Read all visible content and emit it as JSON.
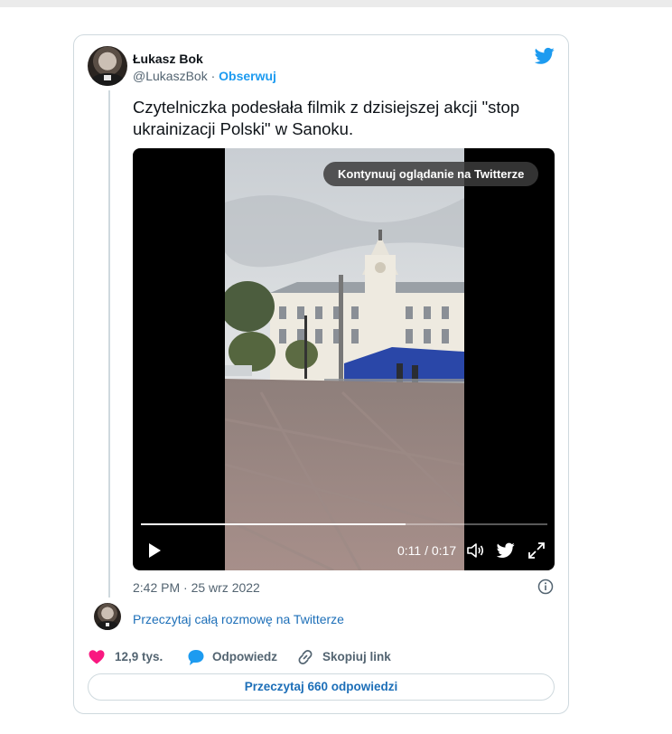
{
  "tweet": {
    "author_name": "Łukasz Bok",
    "author_handle": "@LukaszBok",
    "separator": " · ",
    "follow_label": "Obserwuj",
    "text": "Czytelniczka podesłała filmik z dzisiejszej akcji \"stop ukrainizacji Polski\" w Sanoku.",
    "timestamp": "2:42 PM · 25 wrz 2022"
  },
  "video": {
    "continue_label": "Kontynuuj oglądanie na Twitterze",
    "time_display": "0:11 / 0:17",
    "progress": 0.65
  },
  "conversation": {
    "read_link": "Przeczytaj całą rozmowę na Twitterze"
  },
  "actions": {
    "likes": "12,9 tys.",
    "reply": "Odpowiedz",
    "copy_link": "Skopiuj link"
  },
  "footer": {
    "read_replies": "Przeczytaj 660 odpowiedzi"
  },
  "colors": {
    "accent": "#1d9bf0",
    "like": "#f91880",
    "muted": "#536471"
  }
}
